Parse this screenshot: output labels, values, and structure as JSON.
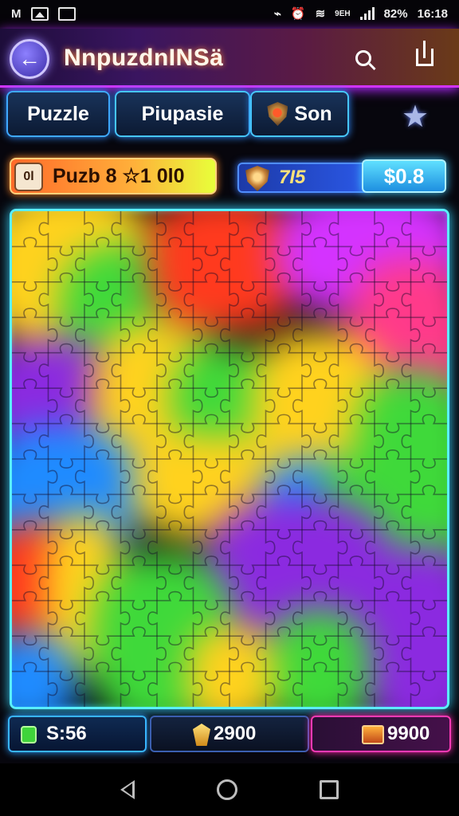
{
  "status_bar": {
    "left_text": "M",
    "battery": "82%",
    "time": "16:18",
    "carrier": "9EH"
  },
  "header": {
    "title": "NnpuzdnINSä"
  },
  "tabs": [
    {
      "label": "Puzzle"
    },
    {
      "label": "Piupasie"
    },
    {
      "label": "Son"
    }
  ],
  "info": {
    "puzzle_label": "Puzb  8  ☆1 0l0",
    "book_glyph": "0l",
    "shield_value": "7I5",
    "price": "$0.8"
  },
  "board": {
    "columns": 12,
    "rows": 14,
    "palette": {
      "green": "#3fd93a",
      "yellow": "#ffd21e",
      "red": "#ff3a1e",
      "purple": "#8b2ae0",
      "magenta": "#d433ff",
      "blue": "#1f8bff",
      "orange": "#ff8a1e"
    }
  },
  "stats": {
    "timer": "S:56",
    "coins": "2900",
    "chest": "9900"
  },
  "colors": {
    "accent_cyan": "#5af0ff",
    "accent_magenta": "#d233ff"
  }
}
